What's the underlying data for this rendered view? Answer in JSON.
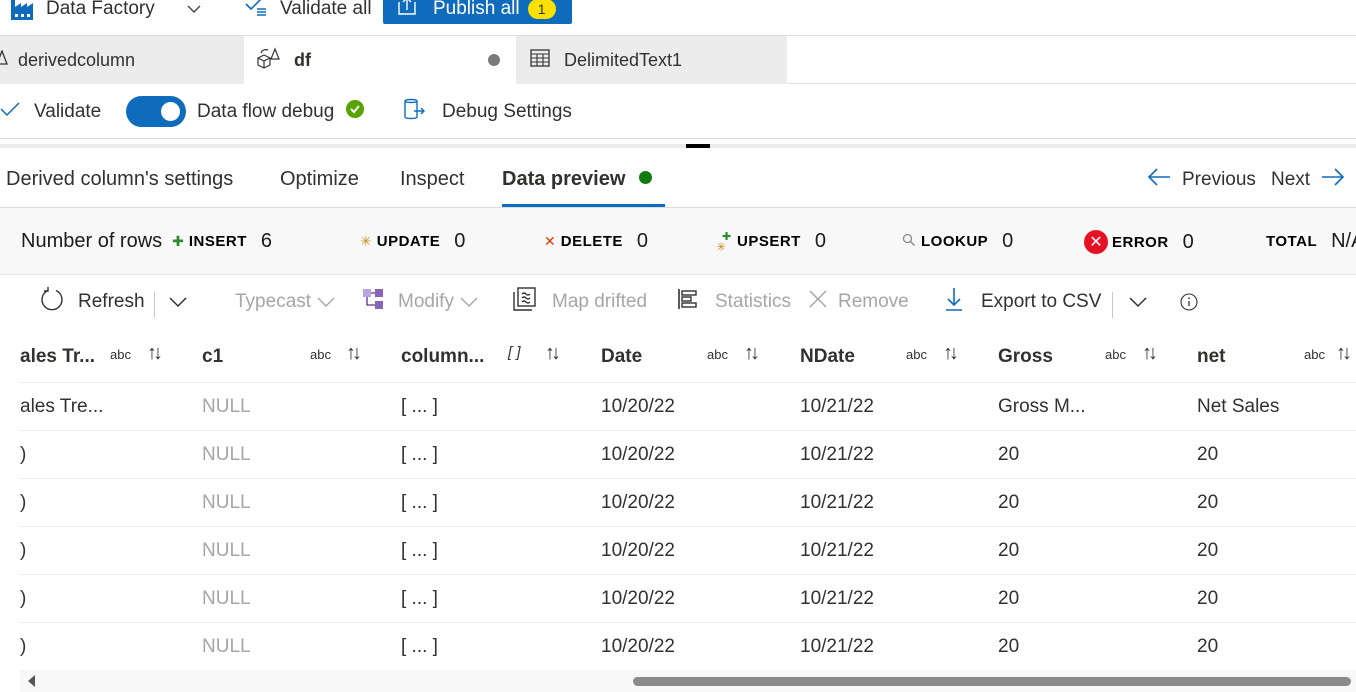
{
  "topbar": {
    "factory_label": "Data Factory",
    "validate_all_label": "Validate all",
    "publish_all_label": "Publish all",
    "publish_badge_count": "1",
    "brand_color": "#0f6cbd"
  },
  "doc_tabs": [
    {
      "label": "derivedcolumn",
      "icon": "derived-column-icon",
      "active": false
    },
    {
      "label": "df",
      "icon": "dataflow-icon",
      "active": true,
      "unsaved": true
    },
    {
      "label": "DelimitedText1",
      "icon": "table-icon",
      "active": false
    }
  ],
  "flow_toolbar": {
    "validate_label": "Validate",
    "debug_label": "Data flow debug",
    "debug_enabled": true,
    "debug_status": "ready",
    "debug_settings_label": "Debug Settings"
  },
  "panel_tabs": {
    "items": [
      {
        "label": "Derived column's settings",
        "active": false
      },
      {
        "label": "Optimize",
        "active": false
      },
      {
        "label": "Inspect",
        "active": false
      },
      {
        "label": "Data preview",
        "active": true,
        "status": "green"
      }
    ],
    "previous_label": "Previous",
    "next_label": "Next"
  },
  "counts": {
    "title": "Number of rows",
    "insert": {
      "label": "INSERT",
      "value": "6"
    },
    "update": {
      "label": "UPDATE",
      "value": "0"
    },
    "delete": {
      "label": "DELETE",
      "value": "0"
    },
    "upsert": {
      "label": "UPSERT",
      "value": "0"
    },
    "lookup": {
      "label": "LOOKUP",
      "value": "0"
    },
    "error": {
      "label": "ERROR",
      "value": "0"
    },
    "total": {
      "label": "TOTAL",
      "value": "N/A"
    }
  },
  "preview_toolbar": {
    "refresh": "Refresh",
    "typecast": "Typecast",
    "modify": "Modify",
    "map_drifted": "Map drifted",
    "statistics": "Statistics",
    "remove": "Remove",
    "export_csv": "Export to CSV"
  },
  "grid": {
    "columns": [
      {
        "name": "ales Tr...",
        "type": "abc"
      },
      {
        "name": "c1",
        "type": "abc"
      },
      {
        "name": "column...",
        "type": "[ ]"
      },
      {
        "name": "Date",
        "type": "abc"
      },
      {
        "name": "NDate",
        "type": "abc"
      },
      {
        "name": "Gross",
        "type": "abc"
      },
      {
        "name": "net",
        "type": "abc"
      }
    ],
    "sort_glyph": "↑↓",
    "rows": [
      [
        "ales Tre...",
        "NULL",
        "[ ... ]",
        "10/20/22",
        "10/21/22",
        "Gross M...",
        "Net Sales"
      ],
      [
        ")",
        "NULL",
        "[ ... ]",
        "10/20/22",
        "10/21/22",
        "20",
        "20"
      ],
      [
        ")",
        "NULL",
        "[ ... ]",
        "10/20/22",
        "10/21/22",
        "20",
        "20"
      ],
      [
        ")",
        "NULL",
        "[ ... ]",
        "10/20/22",
        "10/21/22",
        "20",
        "20"
      ],
      [
        ")",
        "NULL",
        "[ ... ]",
        "10/20/22",
        "10/21/22",
        "20",
        "20"
      ],
      [
        ")",
        "NULL",
        "[ ... ]",
        "10/20/22",
        "10/21/22",
        "20",
        "20"
      ]
    ]
  }
}
